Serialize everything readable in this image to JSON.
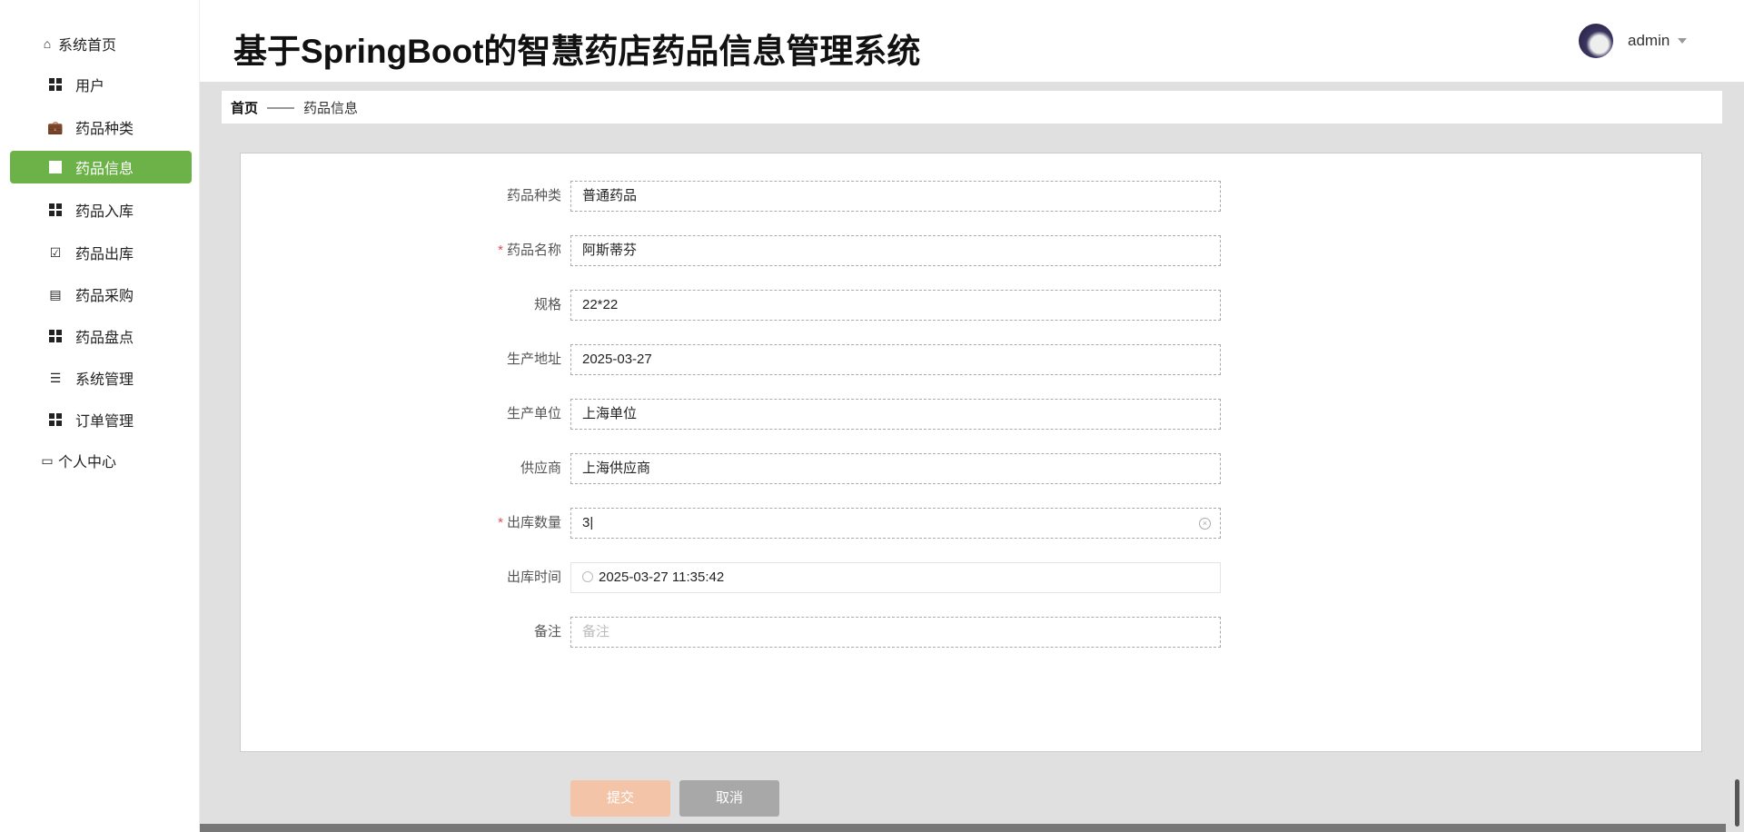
{
  "sidebar": {
    "items": [
      {
        "label": "系统首页",
        "icon": "home-icon"
      },
      {
        "label": "用户",
        "icon": "grid-icon"
      },
      {
        "label": "药品种类",
        "icon": "briefcase-icon"
      },
      {
        "label": "药品信息",
        "icon": "chart-icon",
        "active": true
      },
      {
        "label": "药品入库",
        "icon": "grid-icon"
      },
      {
        "label": "药品出库",
        "icon": "clipboard-check-icon"
      },
      {
        "label": "药品采购",
        "icon": "clipboard-icon"
      },
      {
        "label": "药品盘点",
        "icon": "grid-icon"
      },
      {
        "label": "系统管理",
        "icon": "list-icon"
      },
      {
        "label": "订单管理",
        "icon": "grid-icon"
      },
      {
        "label": "个人中心",
        "icon": "card-icon"
      }
    ]
  },
  "header": {
    "title": "基于SpringBoot的智慧药店药品信息管理系统",
    "user": "admin"
  },
  "breadcrumb": {
    "home": "首页",
    "sep": "——",
    "current": "药品信息"
  },
  "form": {
    "fields": [
      {
        "label": "药品种类",
        "value": "普通药品"
      },
      {
        "label": "药品名称",
        "value": "阿斯蒂芬",
        "required": true
      },
      {
        "label": "规格",
        "value": "22*22"
      },
      {
        "label": "生产地址",
        "value": "2025-03-27"
      },
      {
        "label": "生产单位",
        "value": "上海单位"
      },
      {
        "label": "供应商",
        "value": "上海供应商"
      },
      {
        "label": "出库数量",
        "value": "3",
        "required": true
      },
      {
        "label": "出库时间",
        "value": "2025-03-27 11:35:42"
      },
      {
        "label": "备注",
        "placeholder": "备注"
      }
    ],
    "submit": "提交",
    "cancel": "取消"
  },
  "colors": {
    "accent": "#6db248",
    "submit": "#f4c4a8",
    "cancel": "#a8a8a8"
  }
}
